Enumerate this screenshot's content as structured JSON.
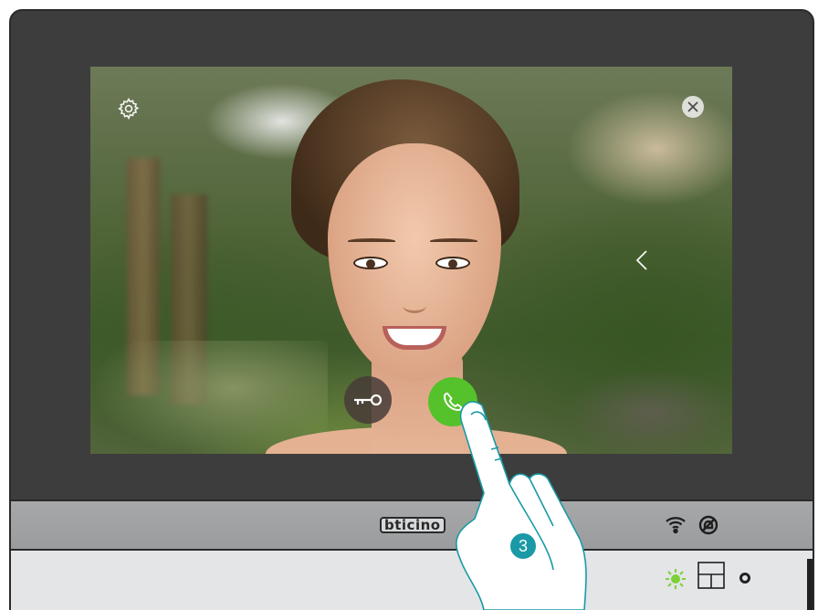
{
  "device": {
    "brand_label": "bticino"
  },
  "screen": {
    "settings_icon": "gear-icon",
    "close_icon": "close-icon",
    "back_icon": "chevron-left-icon",
    "door_lock_icon": "key-icon",
    "answer_icon": "phone-handset-icon"
  },
  "status": {
    "wifi_icon": "wifi-icon",
    "dnd_icon": "do-not-disturb-icon",
    "led_icon": "led-indicator-icon",
    "panel_icon": "panel-layout-icon",
    "mic_icon": "microphone-icon"
  },
  "instruction": {
    "step_number": "3"
  },
  "colors": {
    "answer_button": "#55c22b",
    "step_badge": "#1a9aa6",
    "led": "#7bd13a",
    "device_frame": "#3d3d3d"
  }
}
